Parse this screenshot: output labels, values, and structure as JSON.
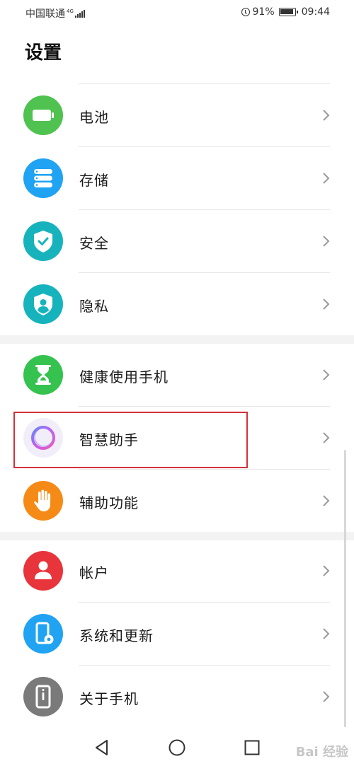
{
  "status_bar": {
    "carrier": "中国联通",
    "network": "4G",
    "battery_percent": "91%",
    "time": "09:44"
  },
  "page": {
    "title": "设置"
  },
  "items": [
    {
      "label": "电池",
      "icon": "battery-icon",
      "color": "#4fc24f"
    },
    {
      "label": "存储",
      "icon": "storage-icon",
      "color": "#1fa3f2"
    },
    {
      "label": "安全",
      "icon": "shield-check-icon",
      "color": "#16b3bd"
    },
    {
      "label": "隐私",
      "icon": "privacy-icon",
      "color": "#16b3bd"
    },
    {
      "label": "健康使用手机",
      "icon": "hourglass-icon",
      "color": "#35c24f"
    },
    {
      "label": "智慧助手",
      "icon": "assistant-ring-icon",
      "color": "#f1eefa"
    },
    {
      "label": "辅助功能",
      "icon": "hand-icon",
      "color": "#f58b16"
    },
    {
      "label": "帐户",
      "icon": "account-icon",
      "color": "#e8343b"
    },
    {
      "label": "系统和更新",
      "icon": "system-update-icon",
      "color": "#1fa3f2"
    },
    {
      "label": "关于手机",
      "icon": "about-phone-icon",
      "color": "#7a7a7a"
    }
  ],
  "nav": {
    "back": "back-icon",
    "home": "home-icon",
    "recents": "recents-icon"
  },
  "watermark": "Bai 经验"
}
